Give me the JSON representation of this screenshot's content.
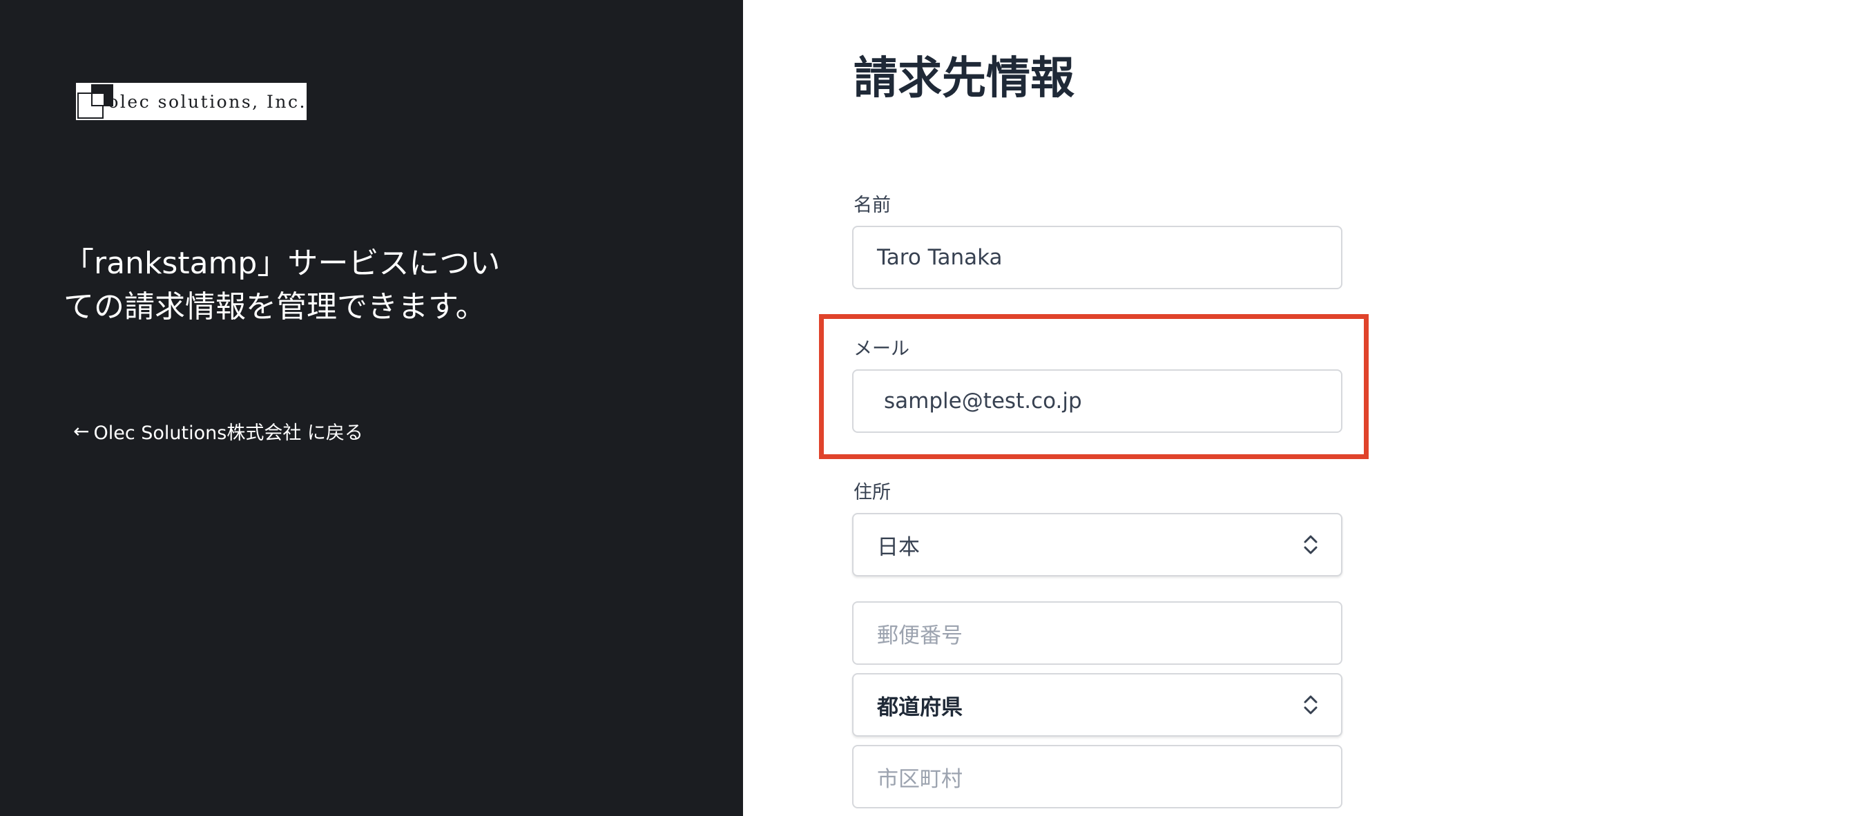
{
  "sidebar": {
    "logo_text": "olec solutions, Inc.",
    "tagline": "「rankstamp」サービスについての請求情報を管理できます。",
    "back_arrow": "←",
    "back_link": "Olec Solutions株式会社 に戻る"
  },
  "form": {
    "title": "請求先情報",
    "name_label": "名前",
    "name_value": "Taro Tanaka",
    "email_label": "メール",
    "email_value": "sample@test.co.jp",
    "address_label": "住所",
    "country_value": "日本",
    "postal_placeholder": "郵便番号",
    "prefecture_value": "都道府県",
    "city_placeholder": "市区町村"
  },
  "colors": {
    "sidebar_bg": "#1b1d21",
    "highlight": "#e0432b"
  }
}
